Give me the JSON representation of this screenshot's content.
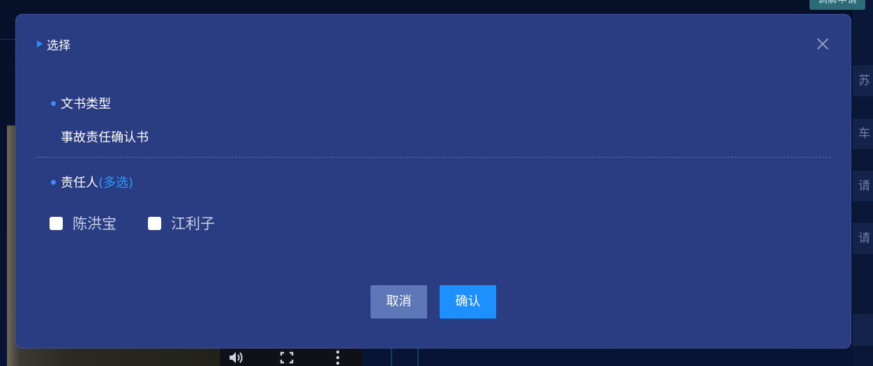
{
  "background": {
    "top_button_label": "调解申请",
    "right_rows": [
      "苏",
      "车",
      "请",
      "请"
    ],
    "video_controls": {
      "volume_icon": "volume-icon",
      "fullscreen_icon": "fullscreen-icon",
      "more_icon": "more-vertical-icon"
    }
  },
  "dialog": {
    "title": "选择",
    "title_icon": "arrow-right-icon",
    "close_icon": "close-icon",
    "doc_type": {
      "label": "文书类型",
      "value": "事故责任确认书"
    },
    "responsible": {
      "label": "责任人",
      "hint": "(多选)",
      "options": [
        {
          "label": "陈洪宝",
          "checked": false
        },
        {
          "label": "江利子",
          "checked": false
        }
      ]
    },
    "buttons": {
      "cancel": "取消",
      "confirm": "确认"
    }
  },
  "colors": {
    "dialog_bg": "#2a3c82",
    "accent": "#1e8fff",
    "hint": "#2f9bff",
    "cancel_bg": "#5e77b6"
  }
}
